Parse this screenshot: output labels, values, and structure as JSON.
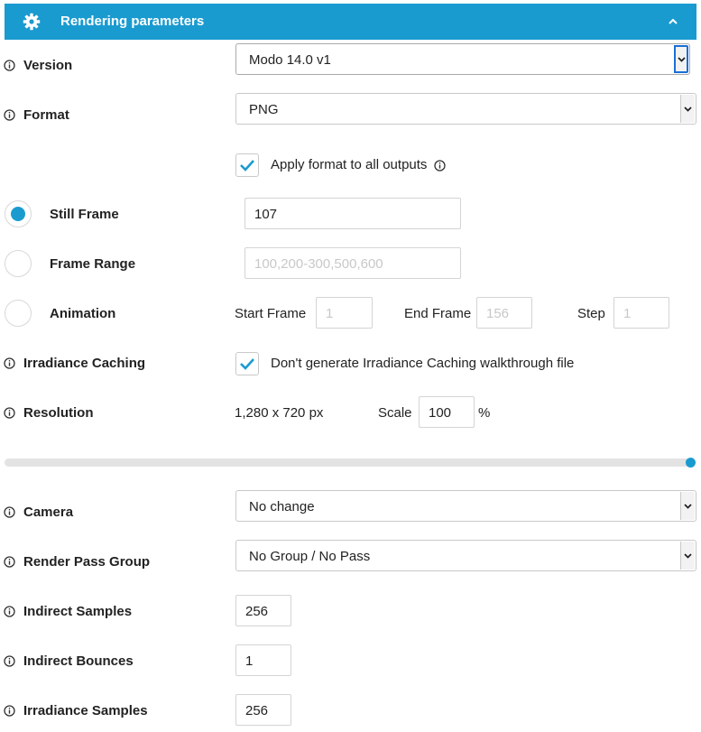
{
  "panel": {
    "title": "Rendering parameters",
    "icons": {
      "settings": "gear-icon",
      "collapse": "chevron-up-icon"
    },
    "accent_color": "#1a9bd0"
  },
  "version": {
    "label": "Version",
    "value": "Modo 14.0 v1"
  },
  "format": {
    "label": "Format",
    "value": "PNG",
    "apply_all_label": "Apply format to all outputs",
    "apply_all_checked": true
  },
  "frames": {
    "still": {
      "label": "Still Frame",
      "value": "107",
      "selected": true
    },
    "range": {
      "label": "Frame Range",
      "placeholder": "100,200-300,500,600",
      "selected": false
    },
    "animation": {
      "label": "Animation",
      "selected": false,
      "start_label": "Start Frame",
      "start_placeholder": "1",
      "end_label": "End Frame",
      "end_placeholder": "156",
      "step_label": "Step",
      "step_placeholder": "1"
    }
  },
  "irradiance_caching": {
    "label": "Irradiance Caching",
    "option_label": "Don't generate Irradiance Caching walkthrough file",
    "checked": true
  },
  "resolution": {
    "label": "Resolution",
    "value": "1,280 x 720 px",
    "scale_label": "Scale",
    "scale_value": "100",
    "scale_unit": "%"
  },
  "quality_slider": {
    "level_percent": 100
  },
  "camera": {
    "label": "Camera",
    "value": "No change"
  },
  "render_pass_group": {
    "label": "Render Pass Group",
    "value": "No Group / No Pass"
  },
  "indirect_samples": {
    "label": "Indirect Samples",
    "value": "256"
  },
  "indirect_bounces": {
    "label": "Indirect Bounces",
    "value": "1"
  },
  "irradiance_samples": {
    "label": "Irradiance Samples",
    "value": "256"
  }
}
